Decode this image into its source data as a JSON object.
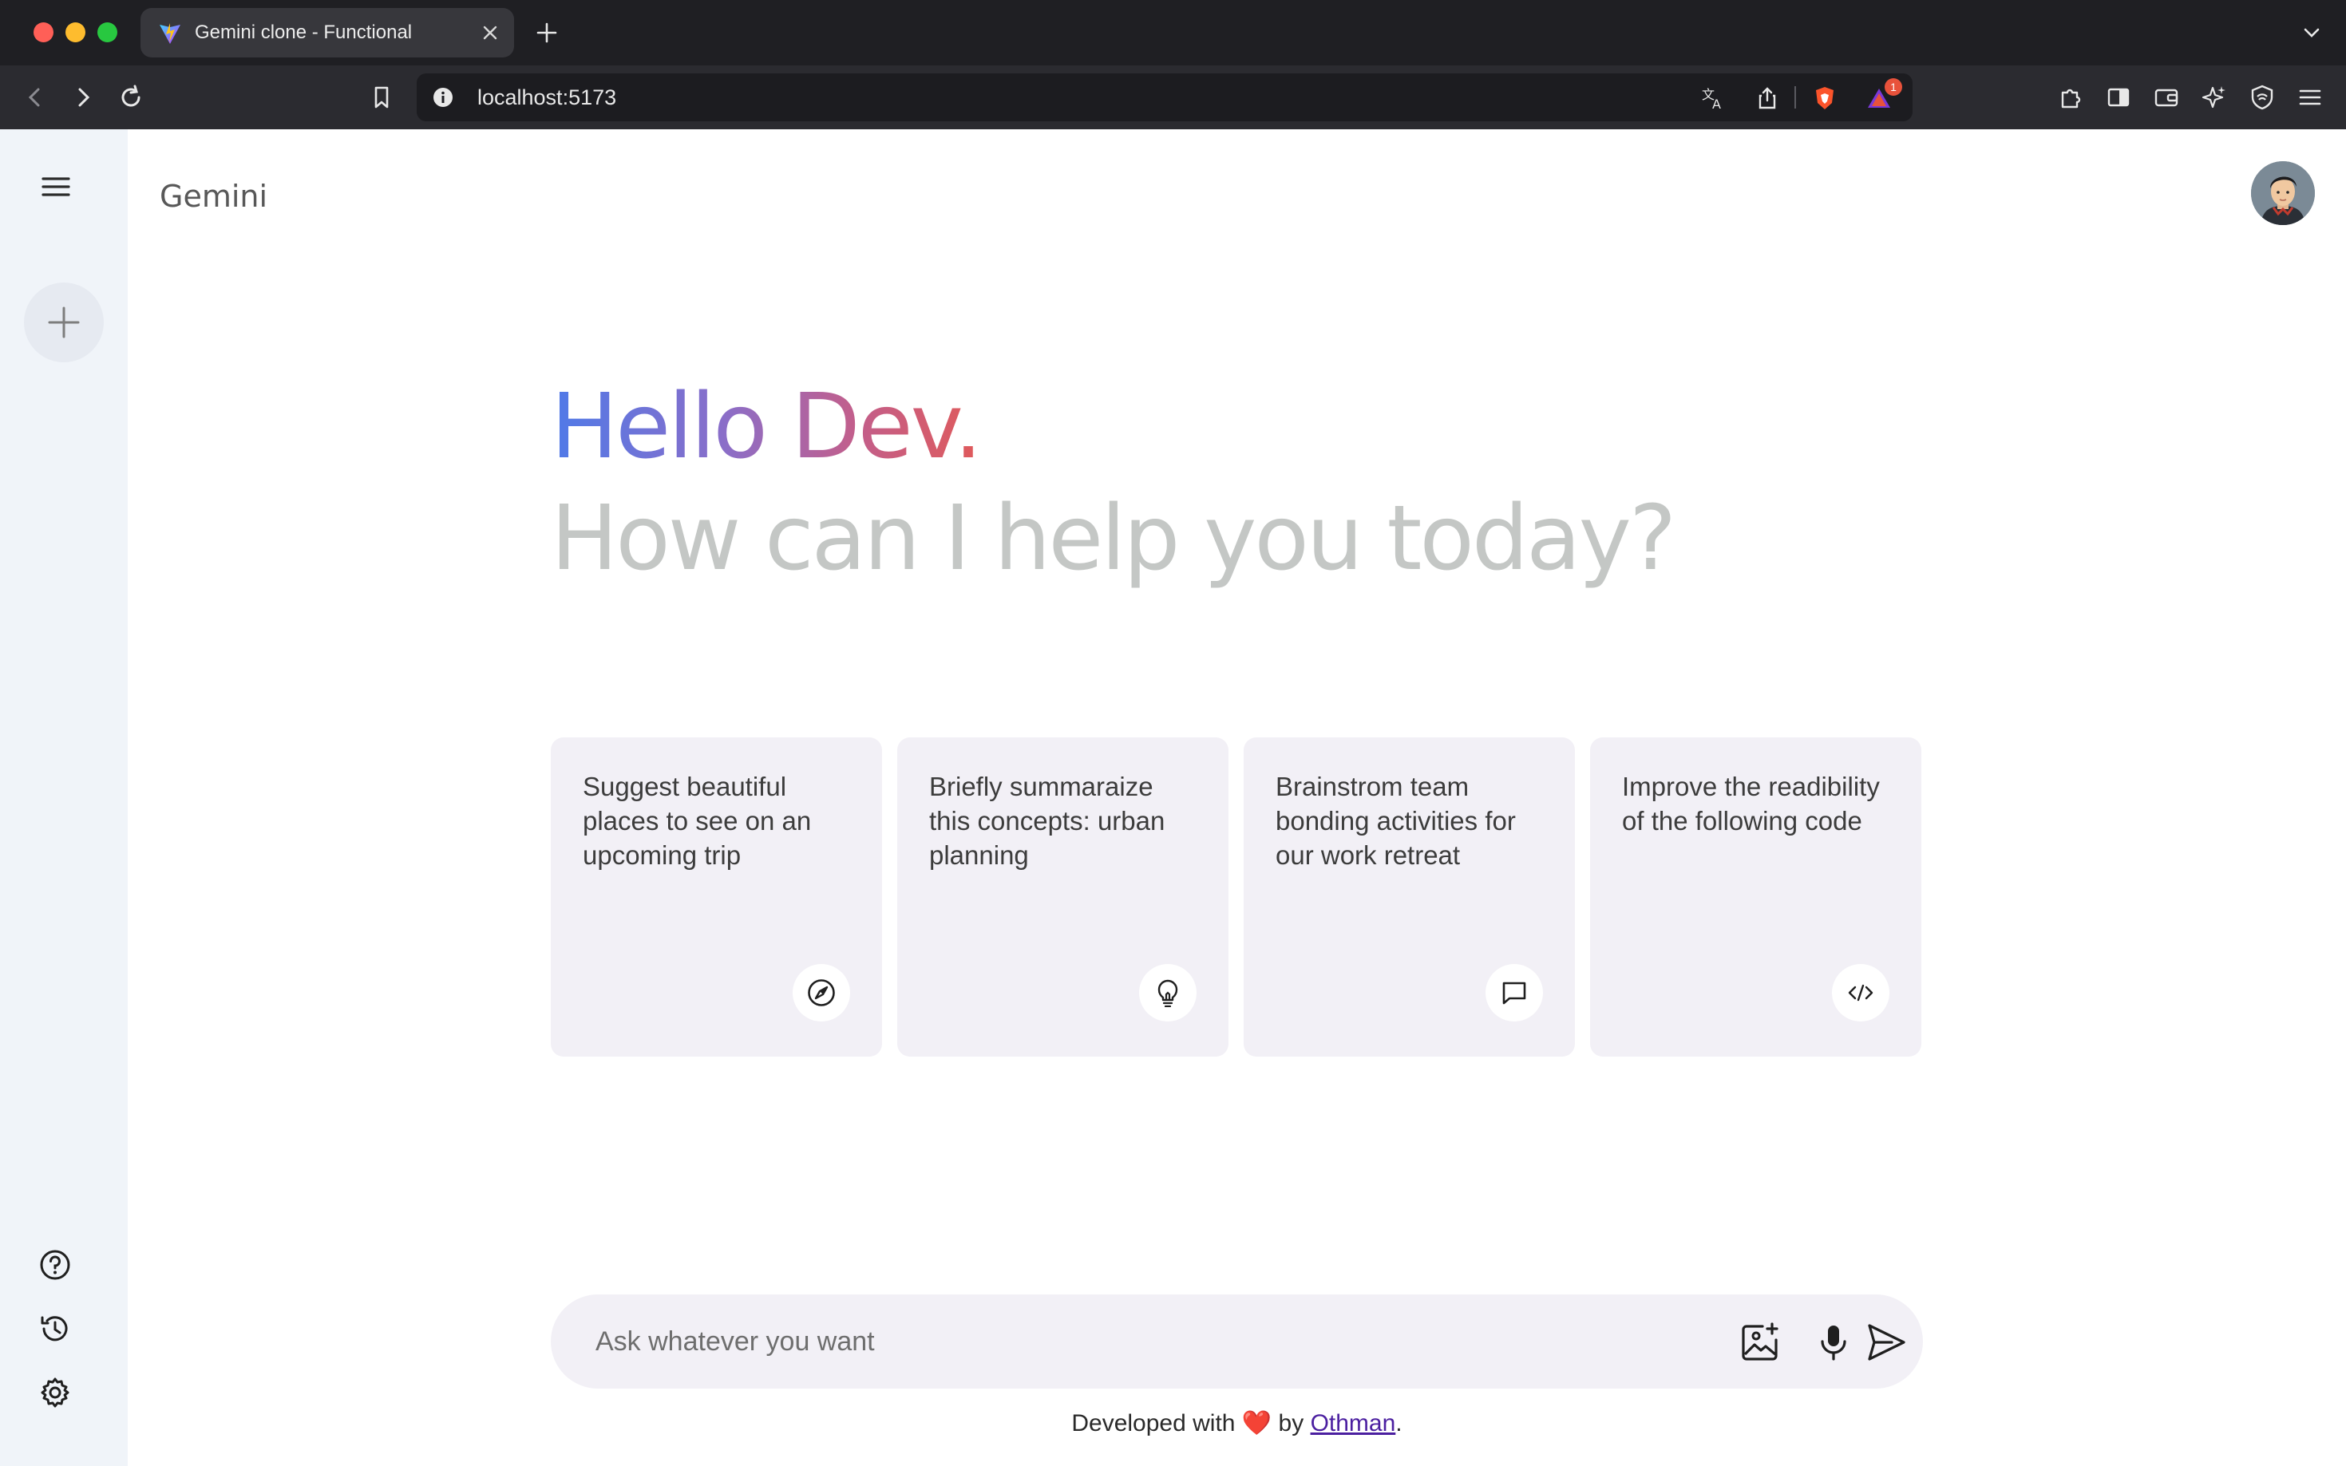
{
  "browser": {
    "tab_title": "Gemini clone - Functional",
    "url": "localhost:5173",
    "notification_count": "1"
  },
  "app": {
    "brand": "Gemini",
    "greeting_hello": "Hello Dev.",
    "greeting_subtitle": "How can I help you today?",
    "cards": [
      {
        "text": "Suggest beautiful places to see on an upcoming trip",
        "icon": "compass-icon"
      },
      {
        "text": "Briefly summaraize this concepts: urban planning",
        "icon": "bulb-icon"
      },
      {
        "text": "Brainstrom team bonding activities for our work retreat",
        "icon": "message-icon"
      },
      {
        "text": "Improve the readibility of the following code",
        "icon": "code-icon"
      }
    ],
    "prompt": {
      "placeholder": "Ask whatever you want",
      "value": ""
    },
    "footer": {
      "prefix": "Developed with",
      "heart": "❤️",
      "by": "by",
      "author": "Othman",
      "suffix": "."
    }
  },
  "colors": {
    "gradient_start": "#4f7ae8",
    "gradient_end": "#e05a5a",
    "sidebar_bg": "#f0f4f9",
    "card_bg": "#f2f0f6",
    "subtitle": "#c4c7c5"
  }
}
